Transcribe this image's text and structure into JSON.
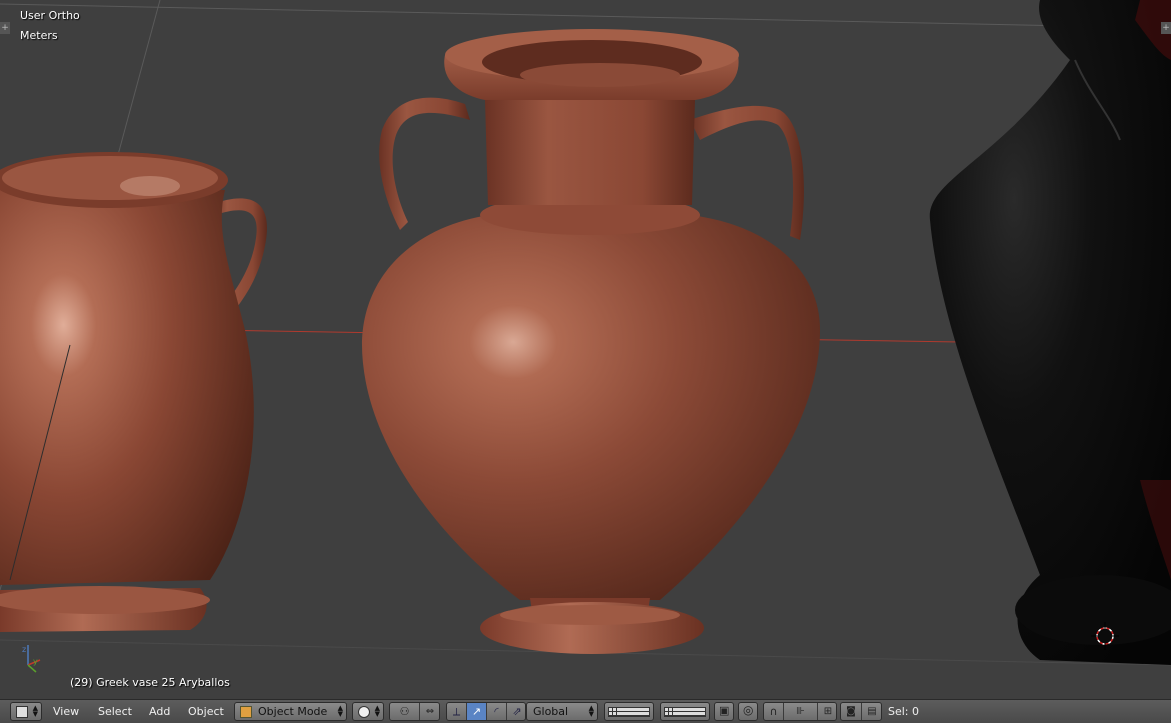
{
  "viewport": {
    "view_name": "User Ortho",
    "units": "Meters",
    "object_info": "(29) Greek vase 25 Aryballos"
  },
  "header": {
    "menus": [
      "View",
      "Select",
      "Add",
      "Object"
    ],
    "mode": "Object Mode",
    "orientation": "Global",
    "selection_count": "Sel: 0"
  },
  "icons": {
    "editor_type": "3d-view-icon",
    "shading": "solid-sphere-icon",
    "pivot": "pivot-point-icon",
    "manipulator": [
      "translate-icon",
      "rotate-icon",
      "scale-icon"
    ],
    "layers": "layer-grid-icon",
    "lock": "lock-icon",
    "proportional": "proportional-edit-icon",
    "snap": "magnet-icon",
    "snap_element": "snap-increment-icon",
    "render": [
      "camera-icon",
      "clapper-icon"
    ]
  },
  "colors": {
    "terracotta": "#8a4a38",
    "black_glaze": "#0d0d0d",
    "axis_x": "#c0392b",
    "selection_blue": "#4f7bbd"
  }
}
